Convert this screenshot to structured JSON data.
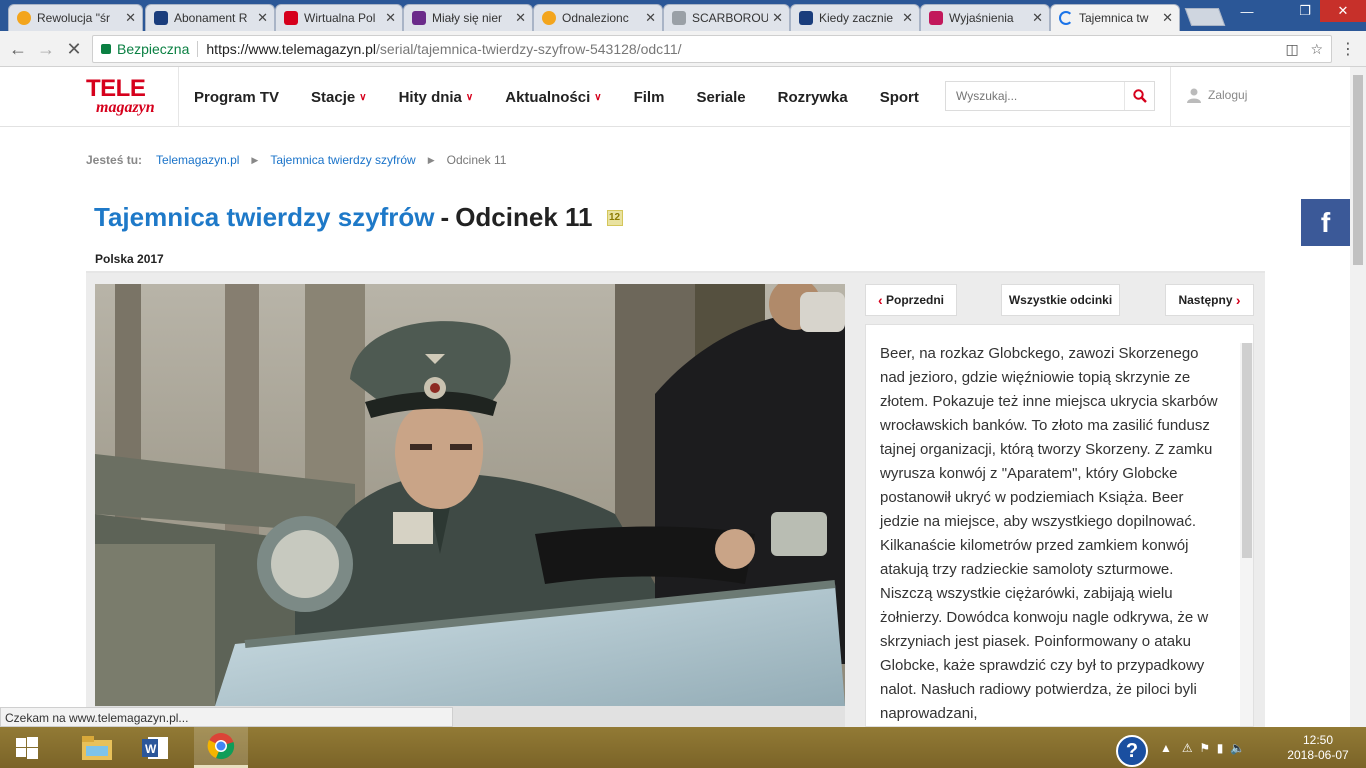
{
  "browser": {
    "tabs": [
      {
        "title": "Rewolucja \"śr",
        "favicon_color": "#f3a51d",
        "favicon": "orange-circle-icon"
      },
      {
        "title": "Abonament R",
        "favicon_color": "#1a3d7c",
        "favicon": "m-logo-icon"
      },
      {
        "title": "Wirtualna Pol",
        "favicon_color": "#d6001c",
        "favicon": "wp-logo-icon"
      },
      {
        "title": "Miały się nier",
        "favicon_color": "#6b2b8a",
        "favicon": "wp-purple-icon"
      },
      {
        "title": "Odnalezionc",
        "favicon_color": "#f3a51d",
        "favicon": "orange-circle-icon"
      },
      {
        "title": "SCARBOROUG",
        "favicon_color": "#9aa0a6",
        "favicon": "document-icon"
      },
      {
        "title": "Kiedy zacznie",
        "favicon_color": "#1a3d7c",
        "favicon": "star-logo-icon"
      },
      {
        "title": "Wyjaśnienia",
        "favicon_color": "#c2185b",
        "favicon": "n-logo-icon"
      },
      {
        "title": "Tajemnica tw",
        "favicon_color": "#1a73e8",
        "favicon": "loading-icon",
        "active": true
      }
    ],
    "secure_label": "Bezpieczna",
    "url_host": "https://www.telemagazyn.pl",
    "url_path": "/serial/tajemnica-twierdzy-szyfrow-543128/odc11/",
    "status_text": "Czekam na www.telemagazyn.pl..."
  },
  "site": {
    "logo_top": "TELE",
    "logo_bottom": "magazyn",
    "menu": [
      {
        "label": "Program TV",
        "has_dropdown": false
      },
      {
        "label": "Stacje",
        "has_dropdown": true
      },
      {
        "label": "Hity dnia",
        "has_dropdown": true
      },
      {
        "label": "Aktualności",
        "has_dropdown": true
      },
      {
        "label": "Film",
        "has_dropdown": false
      },
      {
        "label": "Seriale",
        "has_dropdown": false
      },
      {
        "label": "Rozrywka",
        "has_dropdown": false
      },
      {
        "label": "Sport",
        "has_dropdown": false
      }
    ],
    "search_placeholder": "Wyszukaj...",
    "login_label": "Zaloguj"
  },
  "breadcrumb": {
    "label": "Jesteś tu:",
    "items": [
      "Telemagazyn.pl",
      "Tajemnica twierdzy szyfrów",
      "Odcinek 11"
    ]
  },
  "episode": {
    "series_title": "Tajemnica twierdzy szyfrów",
    "separator": "-",
    "episode_title": "Odcinek 11",
    "age_rating": "12",
    "meta": "Polska 2017",
    "prev_label": "Poprzedni",
    "all_label": "Wszystkie odcinki",
    "next_label": "Następny",
    "description": "Beer, na rozkaz Globckego, zawozi Skorzenego nad jezioro, gdzie więźniowie topią skrzynie ze złotem. Pokazuje też inne miejsca ukrycia skarbów wrocławskich banków. To złoto ma zasilić fundusz tajnej organizacji, którą tworzy Skorzeny. Z zamku wyrusza konwój z \"Aparatem\", który Globcke postanowił ukryć w podziemiach Książa. Beer jedzie na miejsce, aby wszystkiego dopilnować. Kilkanaście kilometrów przed zamkiem konwój atakują trzy radzieckie samoloty szturmowe. Niszczą wszystkie ciężarówki, zabijają wielu żołnierzy. Dowódca konwoju nagle odkrywa, że w skrzyniach jest piasek. Poinformowany o ataku Globcke, każe sprawdzić czy był to przypadkowy nalot. Nasłuch radiowy potwierdza, że piloci byli naprowadzani,"
  },
  "social": {
    "facebook_label": "f"
  },
  "taskbar": {
    "apps": [
      {
        "name": "windows-start-icon"
      },
      {
        "name": "file-explorer-icon"
      },
      {
        "name": "word-icon"
      },
      {
        "name": "chrome-icon",
        "active": true
      }
    ],
    "time": "12:50",
    "date": "2018-06-07",
    "help_label": "?"
  },
  "colors": {
    "brand_red": "#d6001c",
    "link_blue": "#1e79c8",
    "tab_bar": "#2b5797",
    "taskbar": "#86702f",
    "facebook": "#3b5998"
  }
}
